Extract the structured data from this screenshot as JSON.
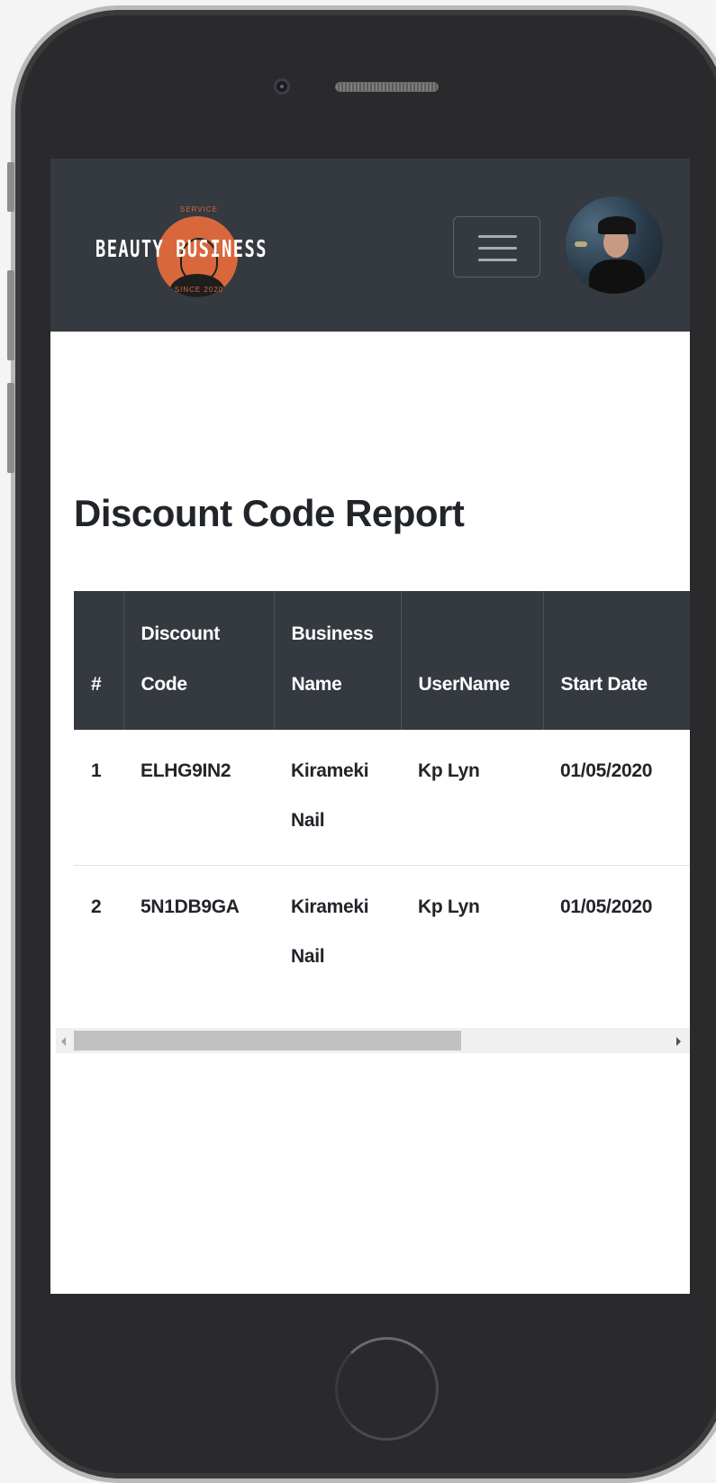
{
  "brand": {
    "top_text": "SERVICE",
    "name_left": "BEAUTY",
    "name_right": "BUSINESS",
    "bottom_text": "SINCE 2020",
    "accent_color": "#d8683c"
  },
  "navbar": {
    "background_color": "#343a40",
    "menu_icon": "hamburger-menu-icon",
    "avatar_icon": "user-avatar"
  },
  "page": {
    "title": "Discount Code Report"
  },
  "table": {
    "headers": [
      "#",
      "Discount Code",
      "Business Name",
      "UserName",
      "Start Date"
    ],
    "rows": [
      [
        "1",
        "ELHG9IN2",
        "Kirameki Nail",
        "Kp Lyn",
        "01/05/2020"
      ],
      [
        "2",
        "5N1DB9GA",
        "Kirameki Nail",
        "Kp Lyn",
        "01/05/2020"
      ]
    ]
  },
  "scrollbar": {
    "position_fraction": 0.0,
    "visible_fraction": 0.62
  }
}
